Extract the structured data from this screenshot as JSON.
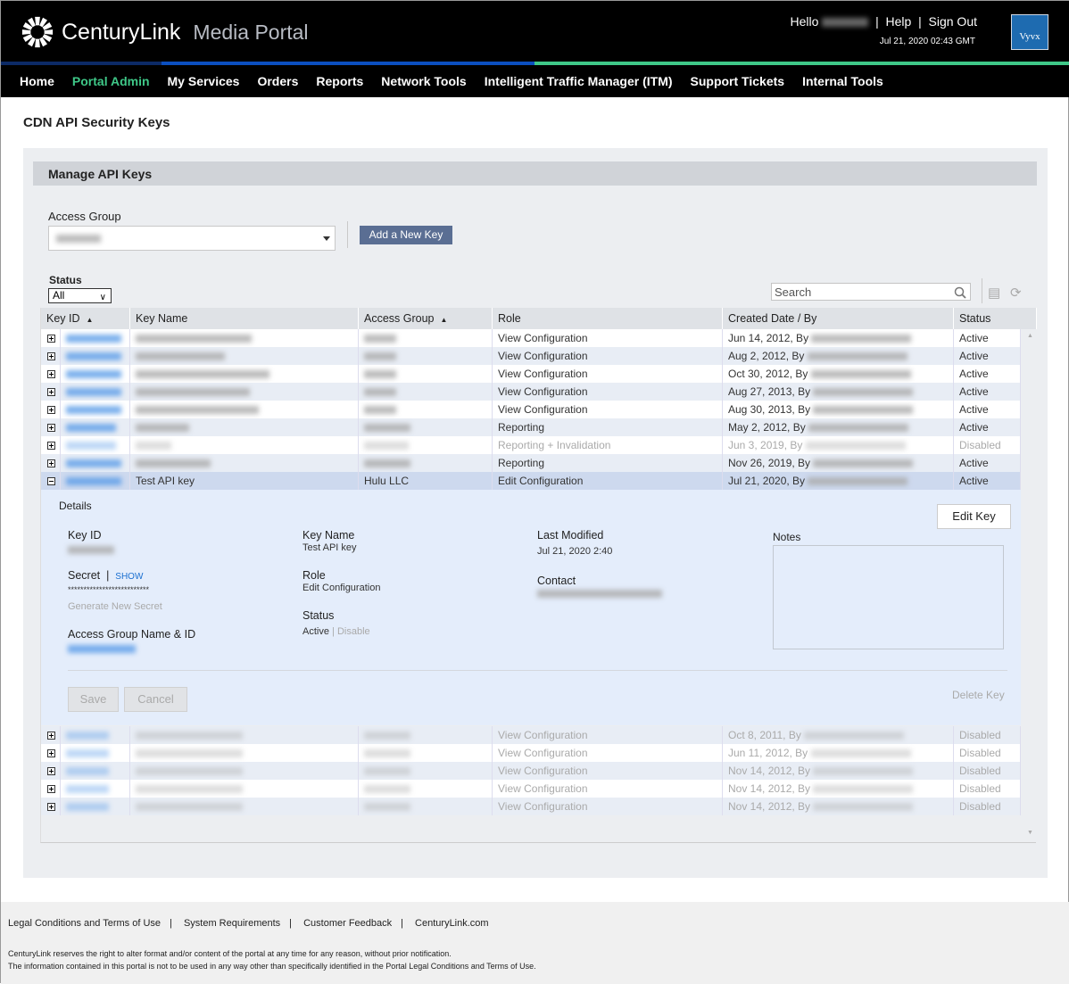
{
  "header": {
    "brand": "CenturyLink",
    "portal_name": "Media Portal",
    "greeting": "Hello",
    "help": "Help",
    "sign_out": "Sign Out",
    "timestamp": "Jul 21, 2020 02:43 GMT",
    "partner_logo": "Vyvx"
  },
  "colors": {
    "nav_active": "#3fc888",
    "bar_navy": "#0c2a66",
    "bar_blue": "#0b4fc0",
    "bar_green": "#3fc888",
    "button": "#5a6e93"
  },
  "nav": [
    "Home",
    "Portal Admin",
    "My Services",
    "Orders",
    "Reports",
    "Network Tools",
    "Intelligent Traffic Manager (ITM)",
    "Support Tickets",
    "Internal Tools"
  ],
  "page_title": "CDN API Security Keys",
  "manage": {
    "title": "Manage API Keys",
    "access_group_label": "Access Group",
    "add_key": "Add a New Key",
    "status_label": "Status",
    "status_value": "All",
    "search_placeholder": "Search"
  },
  "table": {
    "columns": [
      "Key ID",
      "Key Name",
      "Access Group",
      "Role",
      "Created Date / By",
      "Status"
    ],
    "rows": [
      {
        "role": "View Configuration",
        "created": "Jun 14, 2012, By",
        "status": "Active"
      },
      {
        "role": "View Configuration",
        "created": "Aug 2, 2012, By",
        "status": "Active"
      },
      {
        "role": "View Configuration",
        "created": "Oct 30, 2012, By",
        "status": "Active"
      },
      {
        "role": "View Configuration",
        "created": "Aug 27, 2013, By",
        "status": "Active"
      },
      {
        "role": "View Configuration",
        "created": "Aug 30, 2013, By",
        "status": "Active"
      },
      {
        "role": "Reporting",
        "created": "May 2, 2012, By",
        "status": "Active"
      },
      {
        "role": "Reporting + Invalidation",
        "created": "Jun 3, 2019, By",
        "status": "Disabled"
      },
      {
        "role": "Reporting",
        "created": "Nov 26, 2019, By",
        "status": "Active"
      },
      {
        "name": "Test API key",
        "group": "Hulu LLC",
        "role": "Edit Configuration",
        "created": "Jul 21, 2020, By",
        "status": "Active"
      }
    ],
    "rows_after": [
      {
        "role": "View Configuration",
        "created": "Oct 8, 2011, By",
        "status": "Disabled"
      },
      {
        "role": "View Configuration",
        "created": "Jun 11, 2012, By",
        "status": "Disabled"
      },
      {
        "role": "View Configuration",
        "created": "Nov 14, 2012, By",
        "status": "Disabled"
      },
      {
        "role": "View Configuration",
        "created": "Nov 14, 2012, By",
        "status": "Disabled"
      },
      {
        "role": "View Configuration",
        "created": "Nov 14, 2012, By",
        "status": "Disabled"
      }
    ]
  },
  "details": {
    "title": "Details",
    "key_id_label": "Key ID",
    "secret_label": "Secret",
    "show": "SHOW",
    "secret_value": "**************************",
    "generate": "Generate New Secret",
    "group_label": "Access Group Name & ID",
    "key_name_label": "Key Name",
    "key_name": "Test API key",
    "role_label": "Role",
    "role": "Edit Configuration",
    "status_label": "Status",
    "status_active": "Active",
    "status_sep": "|",
    "status_disable": "Disable",
    "last_modified_label": "Last Modified",
    "last_modified": "Jul 21, 2020 2:40",
    "contact_label": "Contact",
    "notes_label": "Notes",
    "edit_key": "Edit Key",
    "save": "Save",
    "cancel": "Cancel",
    "delete_key": "Delete Key"
  },
  "footer": {
    "links": [
      "Legal Conditions and Terms of Use",
      "System Requirements",
      "Customer Feedback",
      "CenturyLink.com"
    ],
    "note1": "CenturyLink reserves the right to alter format and/or content of the portal at any time for any reason, without prior notification.",
    "note2": "The information contained in this portal is not to be used in any way other than specifically identified in the Portal Legal Conditions and Terms of Use."
  }
}
